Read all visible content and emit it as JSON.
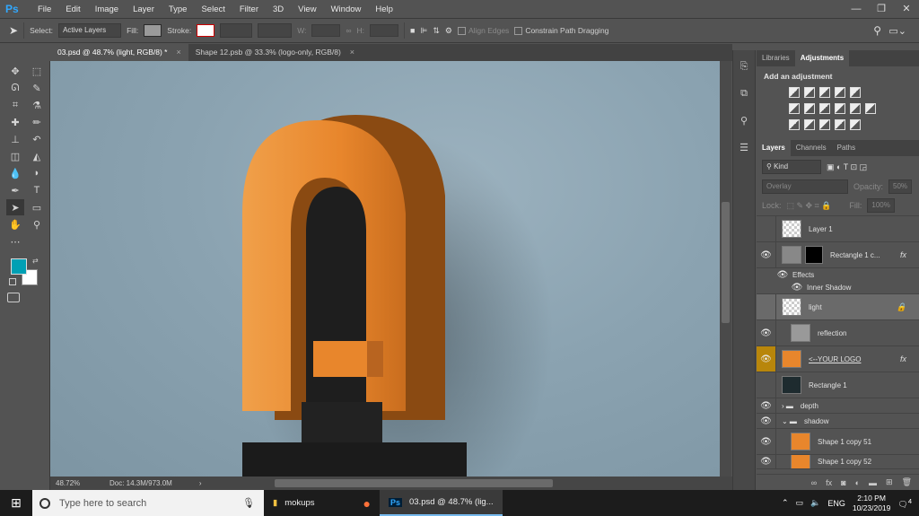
{
  "menubar": {
    "logo": "Ps",
    "items": [
      "File",
      "Edit",
      "Image",
      "Layer",
      "Type",
      "Select",
      "Filter",
      "3D",
      "View",
      "Window",
      "Help"
    ],
    "window_controls": [
      "—",
      "❐",
      "✕"
    ]
  },
  "options": {
    "select_label": "Select:",
    "select_value": "Active Layers",
    "fill_label": "Fill:",
    "stroke_label": "Stroke:",
    "w_label": "W:",
    "h_label": "H:",
    "align_edges": "Align Edges",
    "constrain": "Constrain Path Dragging"
  },
  "tabs": [
    {
      "label": "03.psd @ 48.7% (light, RGB/8) *",
      "close": "×"
    },
    {
      "label": "Shape 12.psb @ 33.3% (logo-only, RGB/8)",
      "close": "×"
    }
  ],
  "status": {
    "zoom": "48.72%",
    "doc": "Doc: 14.3M/973.0M",
    "arrow": "›"
  },
  "panels": {
    "top_tabs": [
      "Libraries",
      "Adjustments"
    ],
    "add_adjustment": "Add an adjustment",
    "layer_tabs": [
      "Layers",
      "Channels",
      "Paths"
    ],
    "kind_label": "Kind",
    "blend_mode": "Overlay",
    "opacity_label": "Opacity:",
    "opacity_value": "50%",
    "lock_label": "Lock:",
    "fill_label": "Fill:",
    "fill_value": "100%",
    "layers": [
      {
        "name": "Layer 1",
        "visible": false,
        "fx": ""
      },
      {
        "name": "Rectangle 1 c...",
        "visible": true,
        "fx": "fx"
      },
      {
        "name": "Effects",
        "visible": true,
        "fx": ""
      },
      {
        "name": "Inner Shadow",
        "visible": true,
        "fx": ""
      },
      {
        "name": "light",
        "visible": false,
        "fx": ""
      },
      {
        "name": "reflection",
        "visible": true,
        "fx": ""
      },
      {
        "name": "<--YOUR LOGO",
        "visible": true,
        "fx": "fx"
      },
      {
        "name": "Rectangle 1",
        "visible": false,
        "fx": ""
      },
      {
        "name": "depth",
        "visible": true,
        "fx": ""
      },
      {
        "name": "shadow",
        "visible": true,
        "fx": ""
      },
      {
        "name": "Shape 1 copy 51",
        "visible": true,
        "fx": ""
      },
      {
        "name": "Shape 1 copy 52",
        "visible": true,
        "fx": ""
      }
    ]
  },
  "taskbar": {
    "search_placeholder": "Type here to search",
    "items": [
      "mokups",
      "03.psd @ 48.7% (lig..."
    ],
    "lang": "ENG",
    "time": "2:10 PM",
    "date": "10/23/2019",
    "notifications": "4"
  },
  "colors": {
    "foreground": "#00a0b4",
    "background": "#ffffff",
    "logo_orange": "#e8862c"
  }
}
